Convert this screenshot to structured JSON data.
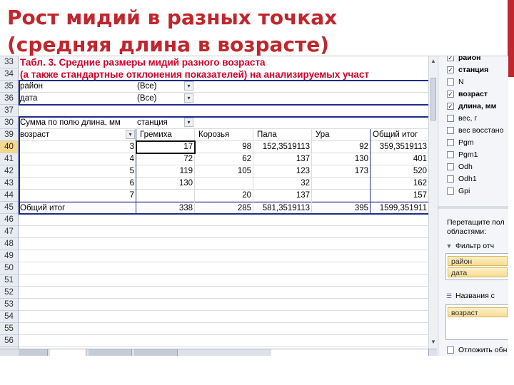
{
  "slide": {
    "title": "Рост мидий в разных точках (средняя длина в возрасте)"
  },
  "colors": {
    "title": "#c0262d",
    "accent_bar": "#c0262d",
    "table_title": "#d0002a",
    "pivot_border": "#1f2b8f",
    "row_header_selected": "#f7d88a"
  },
  "sheet": {
    "row_numbers": [
      "33",
      "34",
      "35",
      "36",
      "37",
      "30",
      "39",
      "40",
      "41",
      "42",
      "43",
      "44",
      "45",
      "46",
      "47",
      "48",
      "49",
      "50",
      "51",
      "52",
      "53",
      "54",
      "55",
      "56"
    ],
    "selected_row": "40",
    "table_title_1": "Табл. 3. Средние размеры мидий разного возраста",
    "table_title_2": "(а также стандартные отклонения показателей) на анализируемых участ",
    "filters": [
      {
        "field": "район",
        "value": "(Все)"
      },
      {
        "field": "дата",
        "value": "(Все)"
      }
    ],
    "data_label": "Сумма по полю длина, мм",
    "column_field": "станция",
    "row_field": "возраст",
    "columns": [
      "Гремиха",
      "Корозья",
      "Пала",
      "Ура",
      "Общий итог"
    ],
    "rows": [
      {
        "age": "3",
        "values": [
          "17",
          "98",
          "152,3519113",
          "92",
          "359,3519113"
        ]
      },
      {
        "age": "4",
        "values": [
          "72",
          "62",
          "137",
          "130",
          "401"
        ]
      },
      {
        "age": "5",
        "values": [
          "119",
          "105",
          "123",
          "173",
          "520"
        ]
      },
      {
        "age": "6",
        "values": [
          "130",
          "",
          "32",
          "",
          "162"
        ]
      },
      {
        "age": "7",
        "values": [
          "",
          "20",
          "137",
          "",
          "157"
        ]
      }
    ],
    "total_label": "Общий итог",
    "totals": [
      "338",
      "285",
      "581,3519113",
      "395",
      "1599,351911"
    ]
  },
  "field_list": {
    "fields": [
      {
        "label": "район",
        "checked": true,
        "bold": true
      },
      {
        "label": "станция",
        "checked": true,
        "bold": true
      },
      {
        "label": "N",
        "checked": false,
        "bold": false
      },
      {
        "label": "возраст",
        "checked": true,
        "bold": true
      },
      {
        "label": "длина, мм",
        "checked": true,
        "bold": true
      },
      {
        "label": "вес, г",
        "checked": false,
        "bold": false
      },
      {
        "label": "вес восстано",
        "checked": false,
        "bold": false
      },
      {
        "label": "Pgm",
        "checked": false,
        "bold": false
      },
      {
        "label": "Pgm1",
        "checked": false,
        "bold": false
      },
      {
        "label": "Odh",
        "checked": false,
        "bold": false
      },
      {
        "label": "Odh1",
        "checked": false,
        "bold": false
      },
      {
        "label": "Gpi",
        "checked": false,
        "bold": false
      }
    ],
    "drag_text_1": "Перетащите пол",
    "drag_text_2": "областями:",
    "filter_header": "Фильтр отч",
    "filter_items": [
      "район",
      "дата"
    ],
    "rows_header": "Названия с",
    "row_items": [
      "возраст"
    ],
    "defer_label": "Отложить обн"
  }
}
